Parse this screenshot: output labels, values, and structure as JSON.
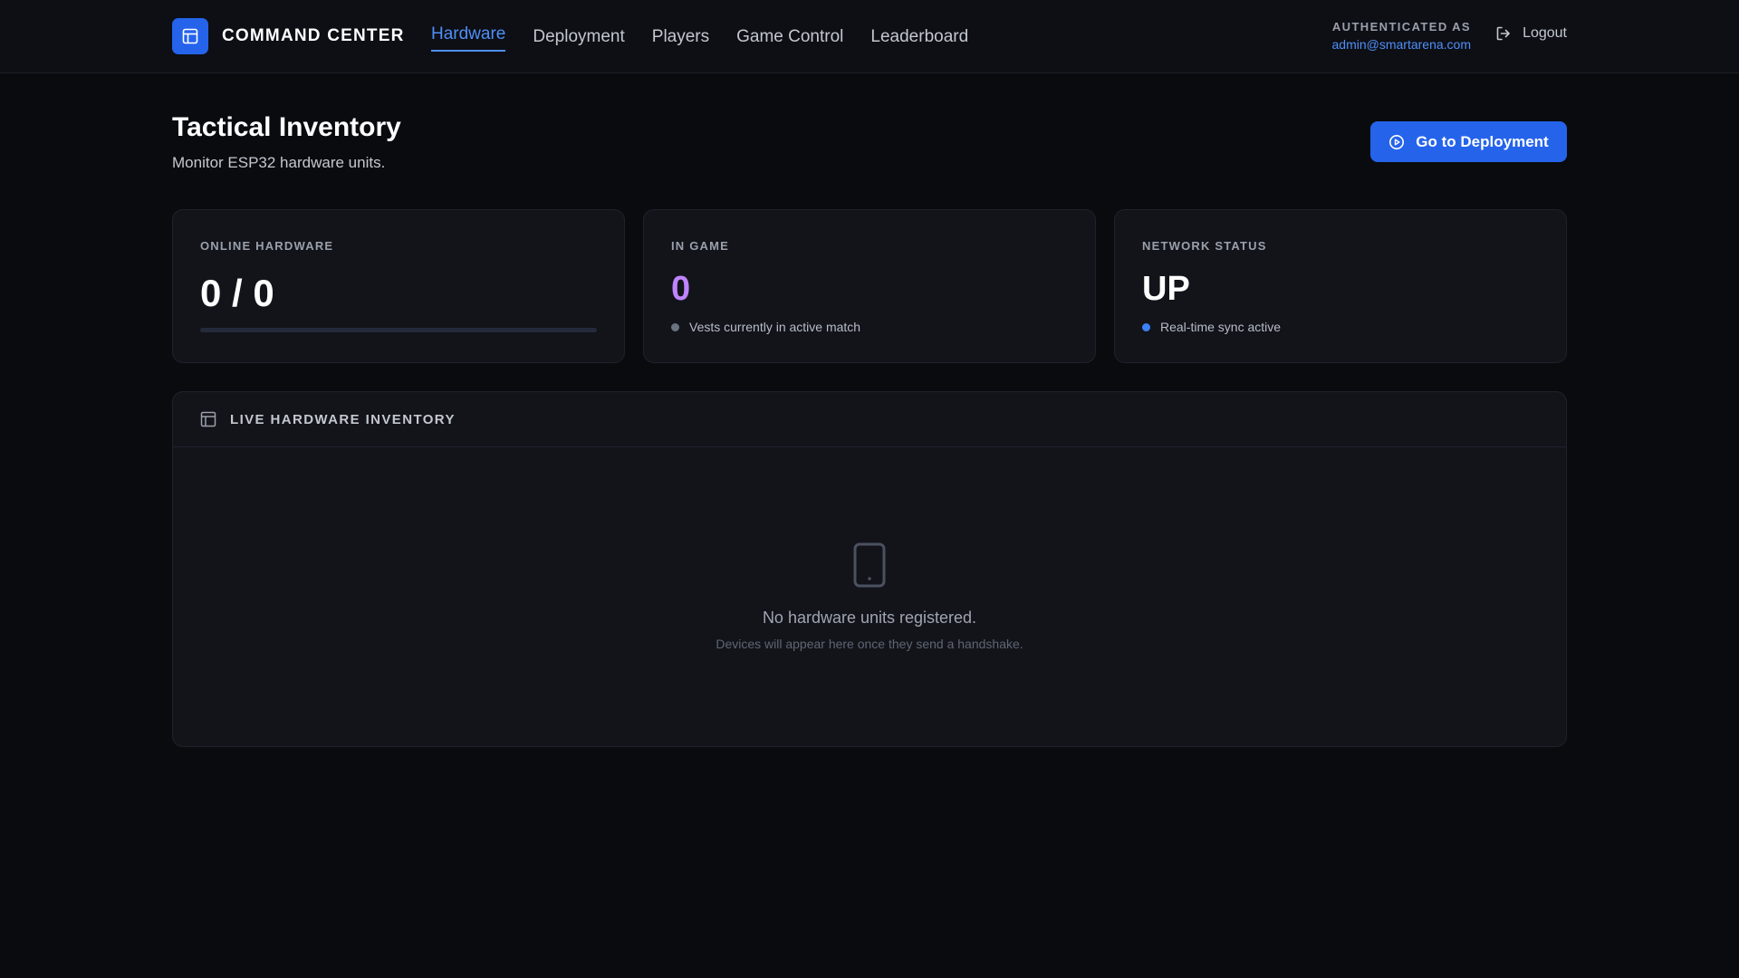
{
  "header": {
    "brand": "COMMAND CENTER",
    "nav": [
      {
        "label": "Hardware",
        "active": true
      },
      {
        "label": "Deployment",
        "active": false
      },
      {
        "label": "Players",
        "active": false
      },
      {
        "label": "Game Control",
        "active": false
      },
      {
        "label": "Leaderboard",
        "active": false
      }
    ],
    "auth_label": "AUTHENTICATED AS",
    "auth_email": "admin@smartarena.com",
    "logout_label": "Logout"
  },
  "page": {
    "title": "Tactical Inventory",
    "subtitle": "Monitor ESP32 hardware units.",
    "deploy_button": "Go to Deployment"
  },
  "stats": {
    "online": {
      "label": "ONLINE HARDWARE",
      "value": "0 / 0",
      "progress": 0
    },
    "in_game": {
      "label": "IN GAME",
      "value": "0",
      "note": "Vests currently in active match"
    },
    "network": {
      "label": "NETWORK STATUS",
      "value": "UP",
      "note": "Real-time sync active"
    }
  },
  "inventory": {
    "title": "LIVE HARDWARE INVENTORY",
    "empty_title": "No hardware units registered.",
    "empty_subtitle": "Devices will appear here once they send a handshake."
  },
  "colors": {
    "accent": "#2563eb",
    "link": "#4f8ff7",
    "purple": "#c084fc",
    "background": "#0a0b0f",
    "card": "#12141a"
  },
  "icons": {
    "brand": "layout-icon",
    "logout": "logout-icon",
    "deploy": "play-circle-icon",
    "panel": "table-icon",
    "empty": "device-icon"
  }
}
